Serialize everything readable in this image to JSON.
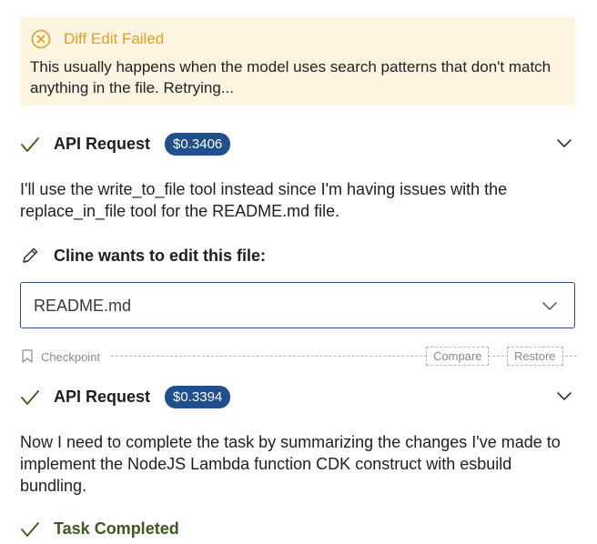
{
  "error": {
    "title": "Diff Edit Failed",
    "message": "This usually happens when the model uses search patterns that don't match anything in the file. Retrying..."
  },
  "api_requests": [
    {
      "label": "API Request",
      "cost": "$0.3406"
    },
    {
      "label": "API Request",
      "cost": "$0.3394"
    }
  ],
  "messages": [
    "I'll use the write_to_file tool instead since I'm having issues with the replace_in_file tool for the README.md file.",
    "Now I need to complete the task by summarizing the changes I've made to implement the NodeJS Lambda function CDK construct with esbuild bundling."
  ],
  "edit": {
    "title": "Cline wants to edit this file:",
    "file_name": "README.md"
  },
  "checkpoint": {
    "label": "Checkpoint",
    "compare_label": "Compare",
    "restore_label": "Restore"
  },
  "completion": {
    "title": "Task Completed"
  },
  "colors": {
    "warning": "#e3a21a",
    "warning_bg": "#fdf4e2",
    "success": "#3d5a1c",
    "badge": "#1f4f8c"
  },
  "icons": [
    "error-circle-icon",
    "check-icon",
    "chevron-down-icon",
    "pencil-icon",
    "bookmark-icon"
  ]
}
